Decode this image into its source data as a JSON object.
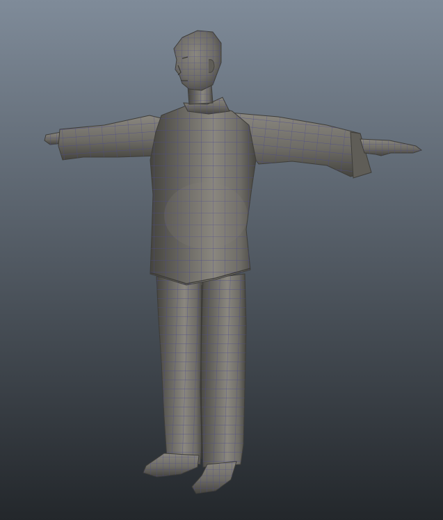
{
  "viewport": {
    "background_top": "#7f8b99",
    "background_bottom": "#23272b",
    "model": {
      "name": "t-pose-character",
      "display_mode": "wireframe-on-shaded",
      "surface_color": "#6e6c66",
      "surface_highlight": "#8a877f",
      "surface_shadow": "#45443f",
      "wire_color": "#4b4a8c"
    }
  }
}
